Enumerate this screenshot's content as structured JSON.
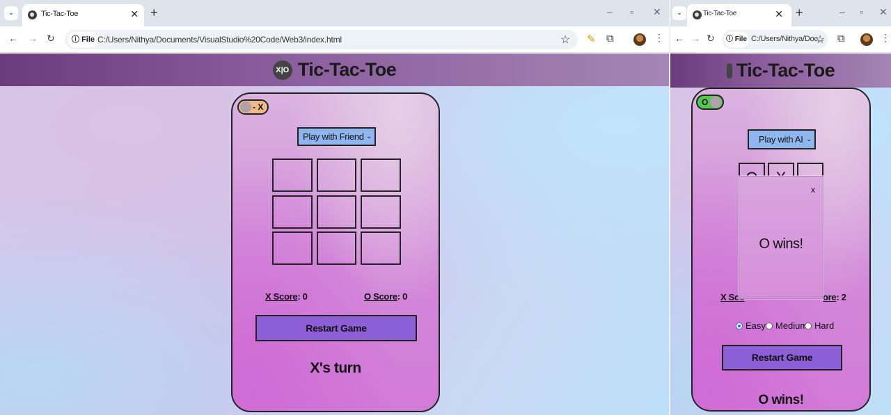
{
  "left_window": {
    "tab": {
      "title": "Tic-Tac-Toe"
    },
    "address": {
      "chip": "File",
      "url": "C:/Users/Nithya/Documents/VisualStudio%20Code/Web3/index.html"
    },
    "page": {
      "title": "Tic-Tac-Toe",
      "logo_text": "X|O",
      "toggle_label": "- X",
      "mode": "Play with Friend",
      "board": [
        "",
        "",
        "",
        "",
        "",
        "",
        "",
        "",
        ""
      ],
      "x_score_label": "X Score",
      "x_score": ": 0",
      "o_score_label": "O Score",
      "o_score": ": 0",
      "restart": "Restart Game",
      "status": "X's turn"
    }
  },
  "right_window": {
    "tab": {
      "title": "Tic-Tac-Toe"
    },
    "address": {
      "chip": "File",
      "url": "C:/Users/Nithya/Doc..."
    },
    "page": {
      "title": "Tic-Tac-Toe",
      "toggle_label": "O -",
      "mode": "Play with AI",
      "board": [
        "O",
        "X",
        "",
        "",
        "",
        "",
        "",
        "",
        ""
      ],
      "x_score_label": "X Sco",
      "o_score_label": "ore",
      "o_score": ": 2",
      "difficulty": {
        "options": [
          "Easy",
          "Medium",
          "Hard"
        ],
        "selected": "Easy"
      },
      "restart": "Restart Game",
      "status": "O wins!",
      "modal": {
        "close": "x",
        "message": "O wins!"
      }
    }
  },
  "colors": {
    "header": "#7a4a8c",
    "card": "#d48ad9",
    "restart": "#8d5fd6",
    "select": "#8fb6ee",
    "toggle_x": "#f0b98c",
    "toggle_o": "#55c94f"
  },
  "icons": [
    "tabs-menu-icon",
    "globe-favicon-icon",
    "back-arrow-icon",
    "forward-arrow-icon",
    "reload-icon",
    "info-icon",
    "bookmark-star-icon",
    "extensions-icon",
    "profile-avatar-icon",
    "menu-kebab-icon"
  ]
}
